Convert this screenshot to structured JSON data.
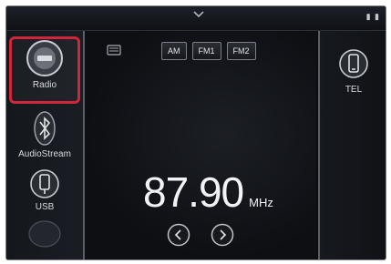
{
  "status_bar": {
    "indicator": "▮ ▮"
  },
  "sources": [
    {
      "label": "Radio",
      "icon": "radio-icon"
    },
    {
      "label": "AudioStream",
      "icon": "bluetooth-icon"
    },
    {
      "label": "USB",
      "icon": "usb-icon"
    }
  ],
  "bands": [
    "AM",
    "FM1",
    "FM2"
  ],
  "tuner": {
    "frequency": "87.90",
    "unit": "MHz"
  },
  "phone": {
    "label": "TEL",
    "icon": "phone-icon"
  },
  "colors": {
    "selection": "#d0263a",
    "background": "#0c0d10"
  }
}
